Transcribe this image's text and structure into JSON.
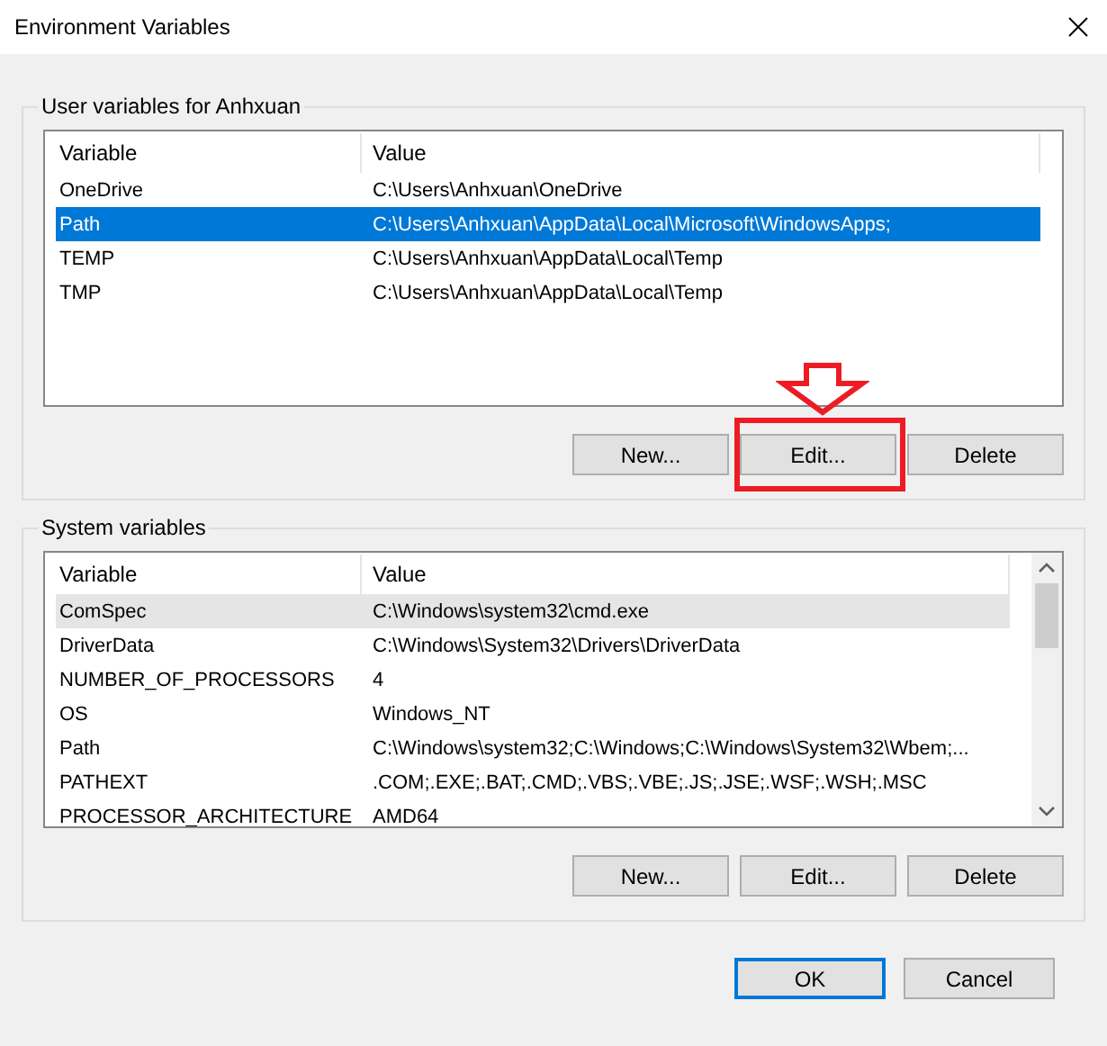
{
  "window": {
    "title": "Environment Variables"
  },
  "user_variables": {
    "title": "User variables for Anhxuan",
    "focused": true,
    "scrollbar": false,
    "columns": [
      "Variable",
      "Value"
    ],
    "rows": [
      {
        "variable": "OneDrive",
        "value": "C:\\Users\\Anhxuan\\OneDrive",
        "selected": false
      },
      {
        "variable": "Path",
        "value": "C:\\Users\\Anhxuan\\AppData\\Local\\Microsoft\\WindowsApps;",
        "selected": true
      },
      {
        "variable": "TEMP",
        "value": "C:\\Users\\Anhxuan\\AppData\\Local\\Temp",
        "selected": false
      },
      {
        "variable": "TMP",
        "value": "C:\\Users\\Anhxuan\\AppData\\Local\\Temp",
        "selected": false
      }
    ],
    "buttons": [
      {
        "label": "New...",
        "highlighted": false
      },
      {
        "label": "Edit...",
        "highlighted": true
      },
      {
        "label": "Delete",
        "highlighted": false
      }
    ]
  },
  "system_variables": {
    "title": "System variables",
    "focused": false,
    "scrollbar": true,
    "columns": [
      "Variable",
      "Value"
    ],
    "rows": [
      {
        "variable": "ComSpec",
        "value": "C:\\Windows\\system32\\cmd.exe",
        "selected": true
      },
      {
        "variable": "DriverData",
        "value": "C:\\Windows\\System32\\Drivers\\DriverData",
        "selected": false
      },
      {
        "variable": "NUMBER_OF_PROCESSORS",
        "value": "4",
        "selected": false
      },
      {
        "variable": "OS",
        "value": "Windows_NT",
        "selected": false
      },
      {
        "variable": "Path",
        "value": "C:\\Windows\\system32;C:\\Windows;C:\\Windows\\System32\\Wbem;...",
        "selected": false
      },
      {
        "variable": "PATHEXT",
        "value": ".COM;.EXE;.BAT;.CMD;.VBS;.VBE;.JS;.JSE;.WSF;.WSH;.MSC",
        "selected": false
      },
      {
        "variable": "PROCESSOR_ARCHITECTURE",
        "value": "AMD64",
        "selected": false
      }
    ],
    "buttons": [
      {
        "label": "New...",
        "highlighted": false
      },
      {
        "label": "Edit...",
        "highlighted": false
      },
      {
        "label": "Delete",
        "highlighted": false
      }
    ]
  },
  "buttons": [
    {
      "label": "OK",
      "default": true
    },
    {
      "label": "Cancel",
      "default": false
    }
  ]
}
